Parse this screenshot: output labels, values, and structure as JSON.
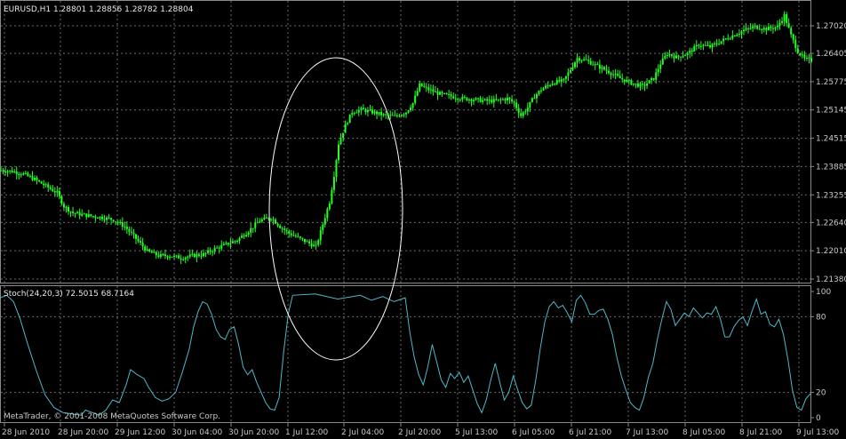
{
  "main_panel": {
    "title": "EURUSD,H1  1.28801 1.28856 1.28782 1.28804"
  },
  "indicator_panel": {
    "title": "Stoch(24,20,3) 72.5015 68.7164",
    "copyright": "MetaTrader, © 2001-2008 MetaQuotes Software Corp."
  },
  "colors": {
    "background": "#000000",
    "grid": "#6a6a6a",
    "candles": "#22ff22",
    "stochastic": "#4fb8c8",
    "ellipse": "#ffffff",
    "text": "#c8c8c8"
  },
  "icons": [
    "ellipse-annotation"
  ],
  "chart_data": [
    {
      "type": "candlestick",
      "symbol": "EURUSD",
      "timeframe": "H1",
      "ylim": [
        1.2138,
        1.2738
      ],
      "y_ticks": [
        "1.27020",
        "1.26405",
        "1.25775",
        "1.25145",
        "1.24515",
        "1.23885",
        "1.23255",
        "1.22640",
        "1.22010",
        "1.21380"
      ],
      "x_ticks": [
        "28 Jun 2010",
        "28 Jun 20:00",
        "29 Jun 12:00",
        "30 Jun 04:00",
        "30 Jun 20:00",
        "1 Jul 12:00",
        "2 Jul 04:00",
        "2 Jul 20:00",
        "5 Jul 13:00",
        "6 Jul 05:00",
        "6 Jul 21:00",
        "7 Jul 13:00",
        "8 Jul 05:00",
        "8 Jul 21:00",
        "9 Jul 13:00"
      ],
      "grid": true,
      "close_path": [
        [
          0,
          1.238
        ],
        [
          5,
          1.2378
        ],
        [
          10,
          1.2372
        ],
        [
          15,
          1.236
        ],
        [
          20,
          1.2345
        ],
        [
          25,
          1.233
        ],
        [
          28,
          1.23
        ],
        [
          32,
          1.2285
        ],
        [
          38,
          1.228
        ],
        [
          45,
          1.2275
        ],
        [
          50,
          1.227
        ],
        [
          55,
          1.2255
        ],
        [
          60,
          1.2228
        ],
        [
          65,
          1.22
        ],
        [
          70,
          1.219
        ],
        [
          75,
          1.219
        ],
        [
          80,
          1.2185
        ],
        [
          85,
          1.219
        ],
        [
          90,
          1.2193
        ],
        [
          95,
          1.2205
        ],
        [
          100,
          1.2215
        ],
        [
          105,
          1.2225
        ],
        [
          110,
          1.2245
        ],
        [
          115,
          1.2268
        ],
        [
          120,
          1.2275
        ],
        [
          124,
          1.2255
        ],
        [
          128,
          1.224
        ],
        [
          132,
          1.223
        ],
        [
          136,
          1.222
        ],
        [
          140,
          1.221
        ],
        [
          143,
          1.226
        ],
        [
          146,
          1.231
        ],
        [
          148,
          1.237
        ],
        [
          150,
          1.244
        ],
        [
          153,
          1.248
        ],
        [
          156,
          1.251
        ],
        [
          160,
          1.2515
        ],
        [
          165,
          1.251
        ],
        [
          170,
          1.2503
        ],
        [
          175,
          1.25
        ],
        [
          180,
          1.251
        ],
        [
          183,
          1.253
        ],
        [
          186,
          1.257
        ],
        [
          190,
          1.256
        ],
        [
          195,
          1.255
        ],
        [
          200,
          1.2545
        ],
        [
          205,
          1.254
        ],
        [
          210,
          1.2538
        ],
        [
          215,
          1.2535
        ],
        [
          220,
          1.2535
        ],
        [
          225,
          1.254
        ],
        [
          228,
          1.253
        ],
        [
          231,
          1.2502
        ],
        [
          234,
          1.252
        ],
        [
          237,
          1.2545
        ],
        [
          240,
          1.256
        ],
        [
          245,
          1.2575
        ],
        [
          250,
          1.258
        ],
        [
          253,
          1.2605
        ],
        [
          256,
          1.263
        ],
        [
          260,
          1.2625
        ],
        [
          265,
          1.2612
        ],
        [
          270,
          1.26
        ],
        [
          275,
          1.2585
        ],
        [
          280,
          1.2575
        ],
        [
          285,
          1.2567
        ],
        [
          290,
          1.2585
        ],
        [
          293,
          1.2618
        ],
        [
          296,
          1.264
        ],
        [
          300,
          1.2632
        ],
        [
          305,
          1.264
        ],
        [
          310,
          1.266
        ],
        [
          315,
          1.2655
        ],
        [
          320,
          1.2668
        ],
        [
          325,
          1.268
        ],
        [
          330,
          1.2692
        ],
        [
          335,
          1.27
        ],
        [
          340,
          1.2695
        ],
        [
          345,
          1.27
        ],
        [
          348,
          1.2725
        ],
        [
          351,
          1.268
        ],
        [
          354,
          1.2645
        ],
        [
          357,
          1.2628
        ],
        [
          360,
          1.2625
        ]
      ]
    },
    {
      "type": "line",
      "name": "Stoch(24,20,3)",
      "ylim": [
        0,
        100
      ],
      "y_ticks": [
        100,
        80,
        20,
        0
      ],
      "values": [
        [
          0,
          95
        ],
        [
          3,
          97
        ],
        [
          6,
          92
        ],
        [
          9,
          78
        ],
        [
          12,
          60
        ],
        [
          16,
          38
        ],
        [
          20,
          18
        ],
        [
          24,
          8
        ],
        [
          28,
          4
        ],
        [
          32,
          3
        ],
        [
          36,
          2
        ],
        [
          38,
          6
        ],
        [
          41,
          4
        ],
        [
          44,
          2
        ],
        [
          47,
          6
        ],
        [
          50,
          14
        ],
        [
          53,
          12
        ],
        [
          56,
          26
        ],
        [
          58,
          38
        ],
        [
          61,
          34
        ],
        [
          64,
          31
        ],
        [
          66,
          24
        ],
        [
          69,
          16
        ],
        [
          72,
          13
        ],
        [
          75,
          15
        ],
        [
          78,
          20
        ],
        [
          81,
          36
        ],
        [
          84,
          54
        ],
        [
          86,
          72
        ],
        [
          88,
          84
        ],
        [
          90,
          92
        ],
        [
          92,
          90
        ],
        [
          94,
          82
        ],
        [
          96,
          70
        ],
        [
          98,
          64
        ],
        [
          100,
          62
        ],
        [
          102,
          70
        ],
        [
          104,
          72
        ],
        [
          106,
          58
        ],
        [
          108,
          40
        ],
        [
          110,
          34
        ],
        [
          112,
          38
        ],
        [
          114,
          28
        ],
        [
          116,
          20
        ],
        [
          118,
          12
        ],
        [
          120,
          7
        ],
        [
          122,
          6
        ],
        [
          124,
          16
        ],
        [
          126,
          52
        ],
        [
          128,
          82
        ],
        [
          130,
          97
        ],
        [
          140,
          98
        ],
        [
          150,
          94
        ],
        [
          160,
          97
        ],
        [
          165,
          93
        ],
        [
          170,
          96
        ],
        [
          175,
          92
        ],
        [
          180,
          95
        ],
        [
          182,
          68
        ],
        [
          184,
          48
        ],
        [
          186,
          34
        ],
        [
          188,
          26
        ],
        [
          190,
          40
        ],
        [
          192,
          58
        ],
        [
          194,
          44
        ],
        [
          196,
          30
        ],
        [
          198,
          24
        ],
        [
          200,
          35
        ],
        [
          202,
          31
        ],
        [
          204,
          36
        ],
        [
          206,
          28
        ],
        [
          208,
          33
        ],
        [
          210,
          22
        ],
        [
          212,
          11
        ],
        [
          214,
          4
        ],
        [
          216,
          14
        ],
        [
          218,
          30
        ],
        [
          220,
          43
        ],
        [
          222,
          28
        ],
        [
          224,
          14
        ],
        [
          226,
          20
        ],
        [
          228,
          33
        ],
        [
          230,
          22
        ],
        [
          232,
          12
        ],
        [
          234,
          7
        ],
        [
          236,
          10
        ],
        [
          238,
          30
        ],
        [
          240,
          55
        ],
        [
          242,
          76
        ],
        [
          244,
          88
        ],
        [
          246,
          92
        ],
        [
          248,
          87
        ],
        [
          250,
          89
        ],
        [
          252,
          83
        ],
        [
          254,
          76
        ],
        [
          256,
          93
        ],
        [
          258,
          97
        ],
        [
          260,
          91
        ],
        [
          262,
          82
        ],
        [
          264,
          82
        ],
        [
          266,
          85
        ],
        [
          268,
          86
        ],
        [
          270,
          78
        ],
        [
          272,
          66
        ],
        [
          274,
          48
        ],
        [
          276,
          33
        ],
        [
          278,
          22
        ],
        [
          280,
          12
        ],
        [
          282,
          8
        ],
        [
          284,
          6
        ],
        [
          286,
          16
        ],
        [
          288,
          32
        ],
        [
          290,
          43
        ],
        [
          292,
          62
        ],
        [
          294,
          78
        ],
        [
          296,
          92
        ],
        [
          298,
          86
        ],
        [
          300,
          73
        ],
        [
          302,
          78
        ],
        [
          304,
          83
        ],
        [
          306,
          80
        ],
        [
          308,
          87
        ],
        [
          310,
          83
        ],
        [
          312,
          79
        ],
        [
          314,
          83
        ],
        [
          316,
          82
        ],
        [
          318,
          88
        ],
        [
          320,
          78
        ],
        [
          322,
          64
        ],
        [
          324,
          64
        ],
        [
          326,
          72
        ],
        [
          328,
          77
        ],
        [
          330,
          80
        ],
        [
          332,
          73
        ],
        [
          334,
          84
        ],
        [
          336,
          94
        ],
        [
          338,
          82
        ],
        [
          340,
          84
        ],
        [
          342,
          74
        ],
        [
          344,
          72
        ],
        [
          346,
          78
        ],
        [
          348,
          66
        ],
        [
          350,
          46
        ],
        [
          352,
          22
        ],
        [
          354,
          8
        ],
        [
          356,
          6
        ],
        [
          358,
          15
        ],
        [
          360,
          19
        ]
      ]
    }
  ]
}
